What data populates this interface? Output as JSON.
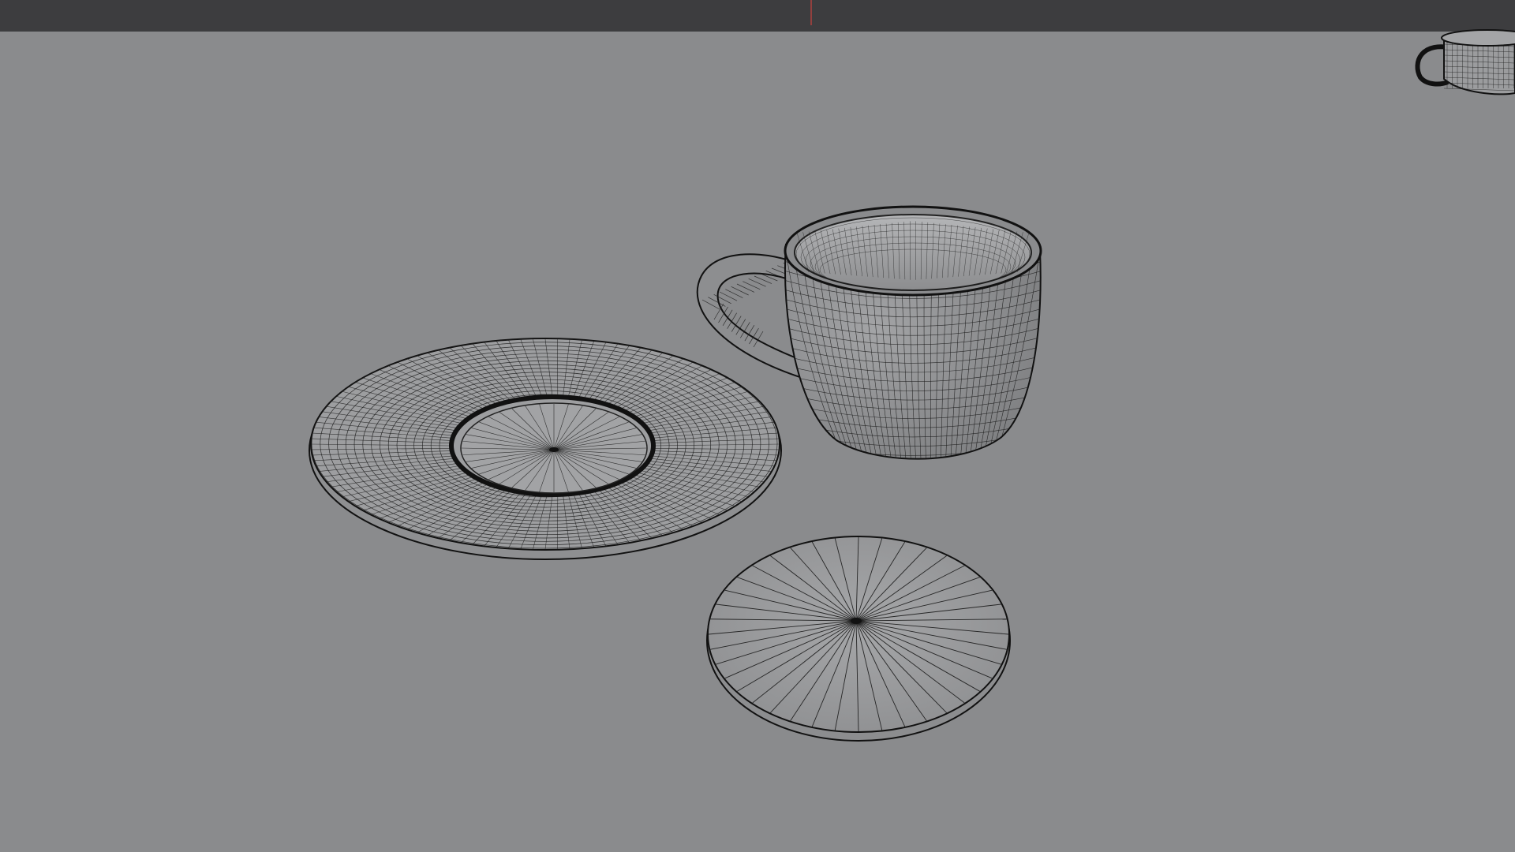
{
  "app": {
    "name": "",
    "view_mode": "wireframe-overlay"
  },
  "viewport": {
    "background_color": "#8a8b8d",
    "object_fill_color": "#9a9b9d",
    "wire_color": "#1a1a1a",
    "objects": [
      {
        "name": "saucer",
        "icon": "saucer-mesh-icon"
      },
      {
        "name": "cup",
        "icon": "cup-mesh-icon"
      },
      {
        "name": "coaster-disc",
        "icon": "disc-mesh-icon"
      },
      {
        "name": "cup-preview",
        "icon": "cup-preview-icon"
      }
    ]
  },
  "top_bar": {
    "color": "#3d3d3f",
    "marker_color": "#b0413e"
  }
}
